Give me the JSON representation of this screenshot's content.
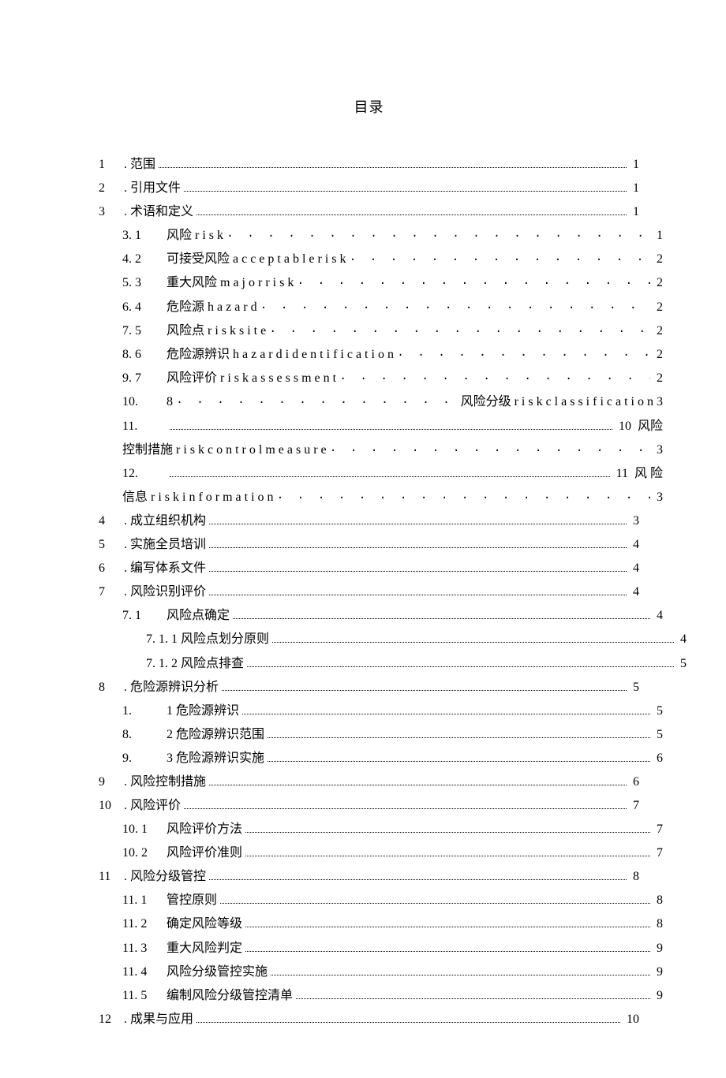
{
  "title": "目录",
  "entries": [
    {
      "level": 1,
      "num": "1",
      "label": ". 范围",
      "dots": "fine",
      "page": "1"
    },
    {
      "level": 1,
      "num": "2",
      "label": ". 引用文件",
      "dots": "fine",
      "page": "1"
    },
    {
      "level": 1,
      "num": "3",
      "label": ". 术语和定义",
      "dots": "fine",
      "page": "1"
    },
    {
      "level": 2,
      "num": "3.  1",
      "label": "风险 r i s k",
      "dots": "wide",
      "page": "1"
    },
    {
      "level": 2,
      "num": "4.  2",
      "label": "可接受风险 a c c e p t a b l e r i s k",
      "dots": "wide",
      "page": "2"
    },
    {
      "level": 2,
      "num": "5.  3",
      "label": "重大风险 m a j o r r i s k",
      "dots": "wide",
      "page": "2"
    },
    {
      "level": 2,
      "num": "6.  4",
      "label": "危险源 h a z a r d",
      "dots": "wide",
      "page": "2"
    },
    {
      "level": 2,
      "num": "7.  5",
      "label": "风险点 r i s k s i t e",
      "dots": "wide",
      "page": "2"
    },
    {
      "level": 2,
      "num": "8.  6",
      "label": "危险源辨识 h a z a r d i d e n t i f i c a t i o n",
      "dots": "wide",
      "page": "2"
    },
    {
      "level": 2,
      "num": "9.  7",
      "label": "风险评价 r i s k a s s e s s m e n t",
      "dots": "wide",
      "page": "2"
    },
    {
      "level": 2,
      "num": "10.",
      "label_prefix": "8",
      "mid_right": "风险分级 r i s k c l a s s i f i c a t i o n 3",
      "dots": "wide",
      "special": "midright"
    },
    {
      "level": 2,
      "num": "11.",
      "label": "",
      "dots": "fine",
      "page": "10",
      "trail": "风险"
    },
    {
      "level": 0,
      "cont": true,
      "label": "控制措施 r i s k c o n t r o l m e a s u r e",
      "dots": "wide",
      "page": "3"
    },
    {
      "level": 2,
      "num": "12.",
      "label": "",
      "dots": "fine",
      "page": "11",
      "trail": "风 险"
    },
    {
      "level": 0,
      "cont": true,
      "label": "信息 r i s k i n f o r m a t i o n",
      "dots": "wide",
      "page": "3"
    },
    {
      "level": 1,
      "num": "4",
      "label": ". 成立组织机构",
      "dots": "fine",
      "page": "3"
    },
    {
      "level": 1,
      "num": "5",
      "label": ". 实施全员培训",
      "dots": "fine",
      "page": "4"
    },
    {
      "level": 1,
      "num": "6",
      "label": ". 编写体系文件",
      "dots": "fine",
      "page": "4"
    },
    {
      "level": 1,
      "num": "7",
      "label": ". 风险识别评价",
      "dots": "fine",
      "page": "4"
    },
    {
      "level": 2,
      "num": "7. 1",
      "label": "风险点确定",
      "dots": "fine",
      "page": "4"
    },
    {
      "level": 3,
      "num": "",
      "label": "7. 1. 1 风险点划分原则",
      "dots": "fine",
      "page": "4"
    },
    {
      "level": 3,
      "num": "",
      "label": "7. 1. 2 风险点排查",
      "dots": "fine",
      "page": "5"
    },
    {
      "level": 1,
      "num": "8",
      "label": ". 危险源辨识分析",
      "dots": "fine",
      "page": "5"
    },
    {
      "level": 2,
      "num": "1.",
      "label": "1 危险源辨识",
      "dots": "fine",
      "page": "5"
    },
    {
      "level": 2,
      "num": "8.",
      "label": "2 危险源辨识范围",
      "dots": "fine",
      "page": "5"
    },
    {
      "level": 2,
      "num": "9.",
      "label": "3 危险源辨识实施",
      "dots": "fine",
      "page": "6"
    },
    {
      "level": 1,
      "num": "9",
      "label": ". 风险控制措施",
      "dots": "fine",
      "page": "6"
    },
    {
      "level": 1,
      "num": "10",
      "label": " . 风险评价",
      "dots": "fine",
      "page": "7"
    },
    {
      "level": 2,
      "num": "10. 1",
      "label": "风险评价方法",
      "dots": "fine",
      "page": "7"
    },
    {
      "level": 2,
      "num": "10. 2",
      "label": "风险评价准则",
      "dots": "fine",
      "page": "7"
    },
    {
      "level": 1,
      "num": "11",
      "label": " . 风险分级管控",
      "dots": "fine",
      "page": "8"
    },
    {
      "level": 2,
      "num": "11. 1",
      "label": "管控原则",
      "dots": "fine",
      "page": "8"
    },
    {
      "level": 2,
      "num": "11. 2",
      "label": "确定风险等级",
      "dots": "fine",
      "page": "8"
    },
    {
      "level": 2,
      "num": "11. 3",
      "label": "重大风险判定",
      "dots": "fine",
      "page": "9"
    },
    {
      "level": 2,
      "num": "11. 4",
      "label": "风险分级管控实施",
      "dots": "fine",
      "page": "9"
    },
    {
      "level": 2,
      "num": "11. 5",
      "label": "编制风险分级管控清单",
      "dots": "fine",
      "page": "9"
    },
    {
      "level": 1,
      "num": "12",
      "label": " . 成果与应用",
      "dots": "fine",
      "page": "10"
    }
  ]
}
